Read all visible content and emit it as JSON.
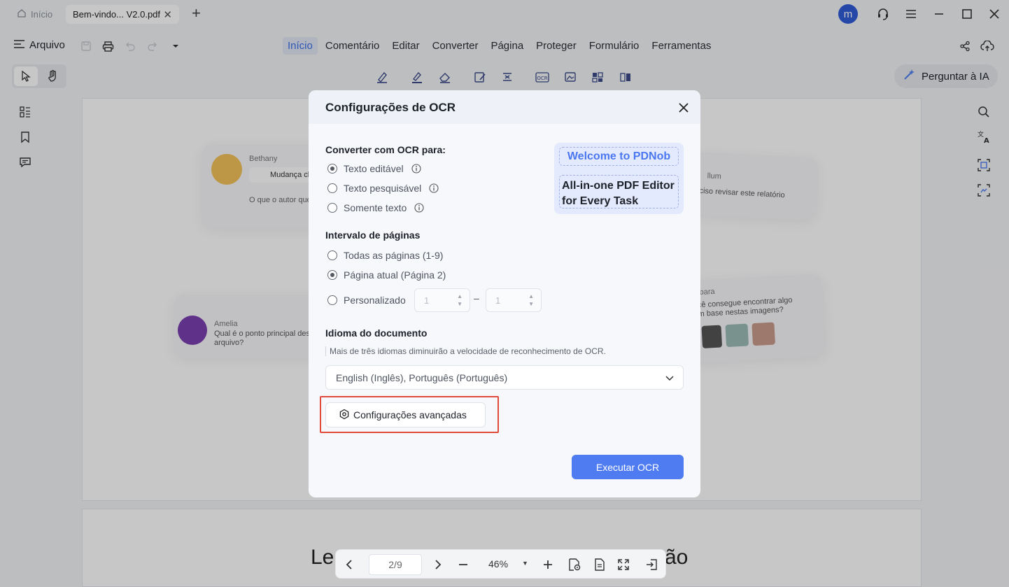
{
  "titlebar": {
    "home_tab": "Início",
    "doc_tab": "Bem-vindo... V2.0.pdf",
    "close_glyph": "✕",
    "new_tab_glyph": "+",
    "avatar_letter": "m"
  },
  "menubar": {
    "file_label": "Arquivo",
    "items": [
      "Início",
      "Comentário",
      "Editar",
      "Converter",
      "Página",
      "Proteger",
      "Formulário",
      "Ferramentas"
    ],
    "active_index": 0
  },
  "toolbar": {
    "ask_ai_label": "Perguntar à IA"
  },
  "document": {
    "bubble_names": [
      "Bethany",
      "Amelia",
      "llum",
      "rbara"
    ],
    "bubble_texts": [
      "Mudança cli",
      "O que o autor que",
      "Qual é o ponto principal des",
      "arquivo?",
      "ciso revisar este relatório",
      "cê consegue encontrar algo",
      "m base nestas imagens?"
    ],
    "big_title_left": "Le",
    "big_title_right": "ão"
  },
  "modal": {
    "title": "Configurações de OCR",
    "convert_title": "Converter com OCR para:",
    "convert_options": [
      "Texto editável",
      "Texto pesquisável",
      "Somente texto"
    ],
    "convert_selected": 0,
    "range_title": "Intervalo de páginas",
    "range_options": [
      "Todas as páginas (1-9)",
      "Página atual (Página 2)",
      "Personalizado"
    ],
    "range_selected": 1,
    "custom_from": "1",
    "custom_to": "1",
    "range_dash": "–",
    "language_title": "Idioma do documento",
    "language_hint": "Mais de três idiomas diminuirão a velocidade de reconhecimento de OCR.",
    "language_value": "English (Inglês), Português (Português)",
    "advanced_label": "Configurações avançadas",
    "run_label": "Executar OCR",
    "preview_line1": "Welcome to PDNob",
    "preview_line2": "All-in-one PDF Editor",
    "preview_line3": "for Every Task"
  },
  "pagebar": {
    "page_value": "2/9",
    "zoom_value": "46%",
    "zoom_arrow": "▼"
  },
  "colors": {
    "accent": "#4f7df1",
    "highlight_border": "#e04a3b",
    "active_menu": "#3b6fe8",
    "avatar": "#2f5bd8"
  },
  "icons": [
    "home-icon",
    "new-tab-icon",
    "headset-icon",
    "hamburger-icon",
    "maximize-icon",
    "close-icon",
    "menu-icon",
    "save-icon",
    "print-icon",
    "undo-icon",
    "redo-icon",
    "share-icon",
    "upload-cloud-icon",
    "cursor-icon",
    "hand-icon",
    "sparkle-icon",
    "thumbnails-icon",
    "bookmark-icon",
    "comment-icon",
    "search-icon",
    "translate-icon",
    "ocr-region-icon",
    "screenshot-icon",
    "info-icon",
    "chevron-down-icon",
    "gear-icon"
  ]
}
